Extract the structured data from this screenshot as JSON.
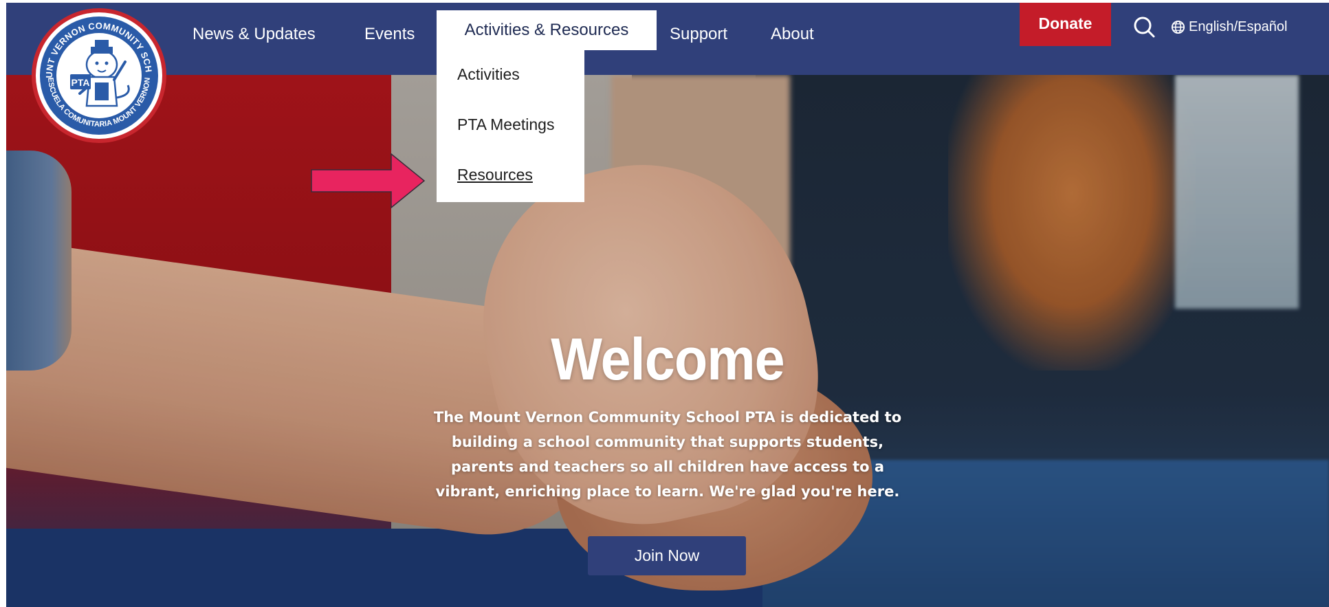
{
  "header": {
    "nav": [
      {
        "label": "News & Updates"
      },
      {
        "label": "Events"
      },
      {
        "label": "Activities & Resources"
      },
      {
        "label": "Support"
      },
      {
        "label": "About"
      }
    ],
    "donate_label": "Donate",
    "language_label": "English/Español",
    "logo_text": {
      "top": "MOUNT VERNON COMMUNITY SCHOOL",
      "bottom": "ESCUELA COMUNITARIA MOUNT VERNON",
      "center": "PTA"
    }
  },
  "dropdown": {
    "items": [
      {
        "label": "Activities"
      },
      {
        "label": "PTA Meetings"
      },
      {
        "label": "Resources"
      }
    ]
  },
  "hero": {
    "title": "Welcome",
    "intro_lines": [
      "The Mount Vernon Community School PTA is dedicated to",
      "building a school community that supports students,",
      "parents and teachers so all children have access to a",
      "vibrant, enriching place to learn. We're glad you're here."
    ],
    "cta_label": "Join Now"
  },
  "colors": {
    "header_bg": "#30407a",
    "donate_bg": "#c41c29",
    "arrow": "#e8245f",
    "cta_bg": "#30407a"
  },
  "icons": [
    "search-icon",
    "globe-icon",
    "arrow-annotation-icon",
    "pta-logo"
  ]
}
